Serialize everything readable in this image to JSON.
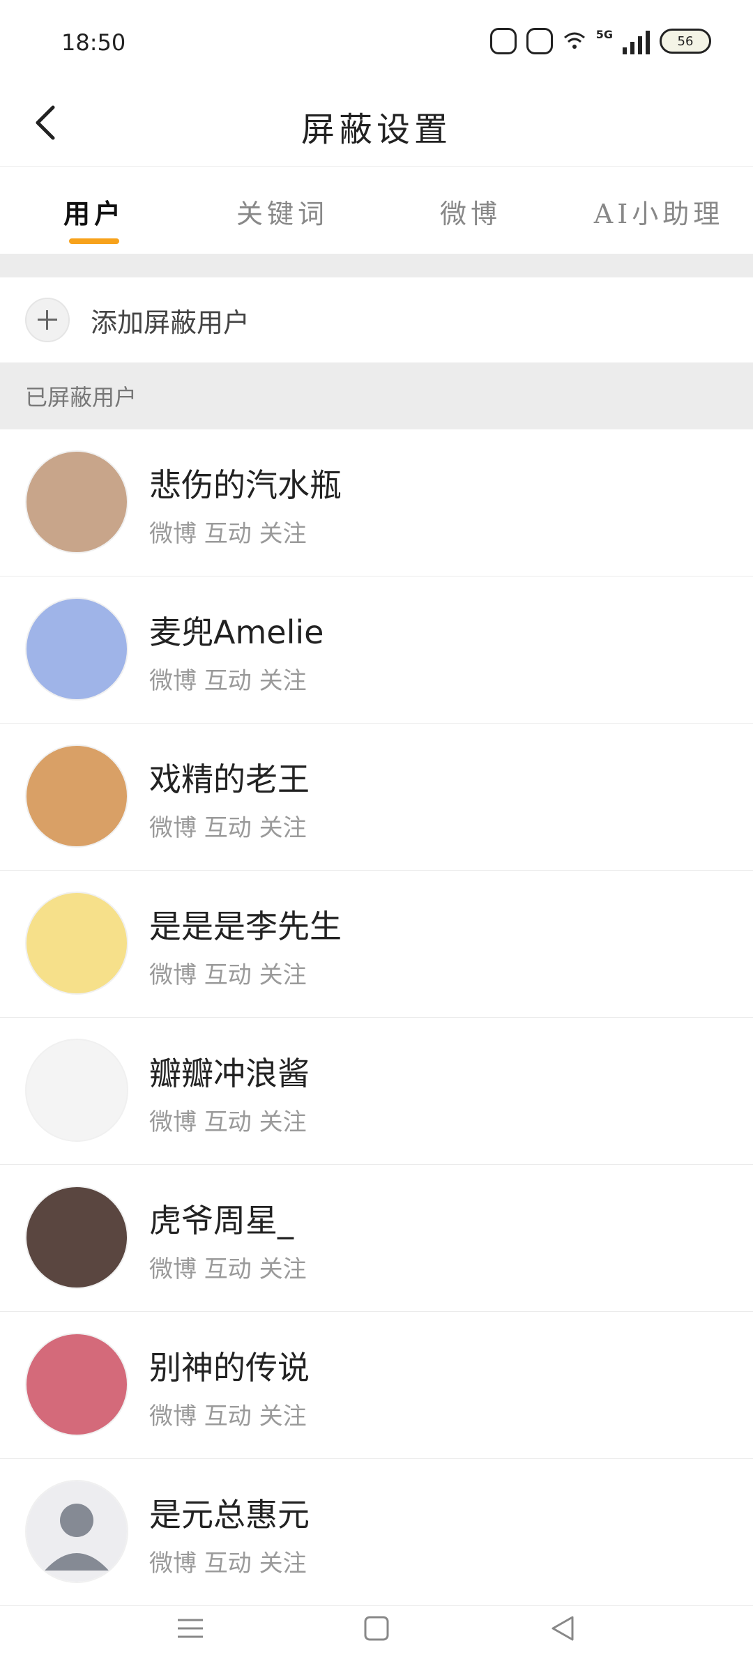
{
  "status_bar": {
    "time": "18:50",
    "network": "5G",
    "battery": "56"
  },
  "header": {
    "title": "屏蔽设置"
  },
  "tabs": [
    {
      "label": "用户",
      "active": true
    },
    {
      "label": "关键词",
      "active": false
    },
    {
      "label": "微博",
      "active": false
    },
    {
      "label": "AI小助理",
      "active": false
    }
  ],
  "add_user": {
    "label": "添加屏蔽用户"
  },
  "section": {
    "label": "已屏蔽用户"
  },
  "users": [
    {
      "name": "悲伤的汽水瓶",
      "meta": "微博 互动 关注",
      "avatar_color": "#c8a58a"
    },
    {
      "name": "麦兜Amelie",
      "meta": "微博 互动 关注",
      "avatar_color": "#9fb4e8"
    },
    {
      "name": "戏精的老王",
      "meta": "微博 互动 关注",
      "avatar_color": "#d9a066"
    },
    {
      "name": "是是是李先生",
      "meta": "微博 互动 关注",
      "avatar_color": "#f6e08a"
    },
    {
      "name": "瓣瓣冲浪酱",
      "meta": "微博 互动 关注",
      "avatar_color": "#f4f4f4"
    },
    {
      "name": "虎爷周星_",
      "meta": "微博 互动 关注",
      "avatar_color": "#5a4640"
    },
    {
      "name": "别神的传说",
      "meta": "微博 互动 关注",
      "avatar_color": "#d46a7a"
    },
    {
      "name": "是元总惠元",
      "meta": "微博 互动 关注",
      "avatar_color": "#cfcfd4"
    }
  ],
  "colors": {
    "accent": "#f7a21b",
    "section_bg": "#ececec"
  }
}
